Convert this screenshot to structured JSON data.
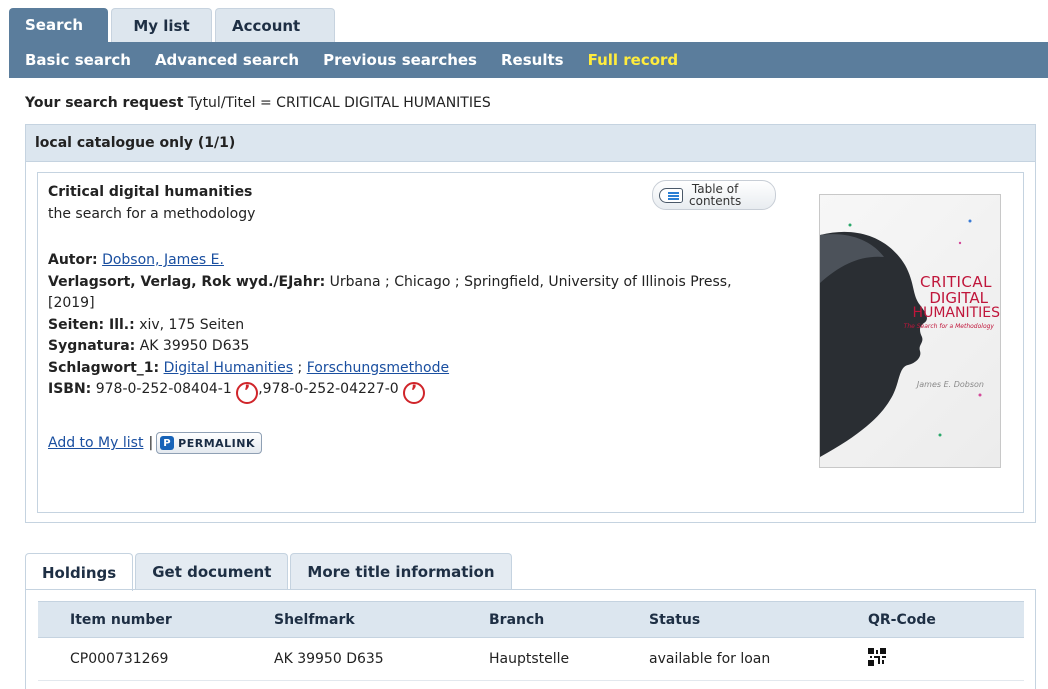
{
  "top_tabs": {
    "search": "Search",
    "mylist": "My list",
    "account": "Account"
  },
  "subnav": {
    "basic": "Basic search",
    "advanced": "Advanced search",
    "previous": "Previous searches",
    "results": "Results",
    "full_record": "Full record"
  },
  "request": {
    "label": "Your search request",
    "value": "Tytul/Titel = CRITICAL DIGITAL HUMANITIES"
  },
  "panel": {
    "header": "local catalogue only (1/1)"
  },
  "record": {
    "title": "Critical digital humanities",
    "subtitle": "the search for a methodology",
    "toc_line1": "Table of",
    "toc_line2": "contents",
    "author_label": "Autor:",
    "author_value": "Dobson, James E.",
    "publisher_label": "Verlagsort, Verlag, Rok wyd./EJahr:",
    "publisher_value": "Urbana ; Chicago ; Springfield, University of Illinois Press, [2019]",
    "pages_label": "Seiten: Ill.:",
    "pages_value": "xiv, 175 Seiten",
    "signature_label": "Sygnatura:",
    "signature_value": "AK 39950 D635",
    "subject_label": "Schlagwort_1:",
    "subject_1": "Digital Humanities",
    "subject_sep": ";",
    "subject_2": "Forschungsmethode",
    "isbn_label": "ISBN:",
    "isbn_1": "978-0-252-08404-1",
    "isbn_sep": ",",
    "isbn_2": "978-0-252-04227-0",
    "add_to_list": "Add to My list",
    "actions_sep": "|",
    "permalink_badge": "P",
    "permalink": "PERMALINK"
  },
  "cover": {
    "line1": "CRITICAL",
    "line2": "DIGITAL",
    "line3": "HUMANITIES",
    "subtitle": "The Search for a Methodology",
    "author": "James E. Dobson"
  },
  "bottom_tabs": {
    "holdings": "Holdings",
    "get_document": "Get document",
    "more_info": "More title information"
  },
  "holdings": {
    "headers": [
      "Item number",
      "Shelfmark",
      "Branch",
      "Status",
      "QR-Code"
    ],
    "rows": [
      [
        "CP000731269",
        "AK 39950 D635",
        "Hauptstelle",
        "available for loan"
      ]
    ]
  },
  "colors": {
    "nav_bg": "#5b7d9c",
    "active_link": "#ffec3d",
    "panel_header": "#dce6ef",
    "link": "#1a4fa0",
    "isbn_icon": "#d0252a"
  }
}
